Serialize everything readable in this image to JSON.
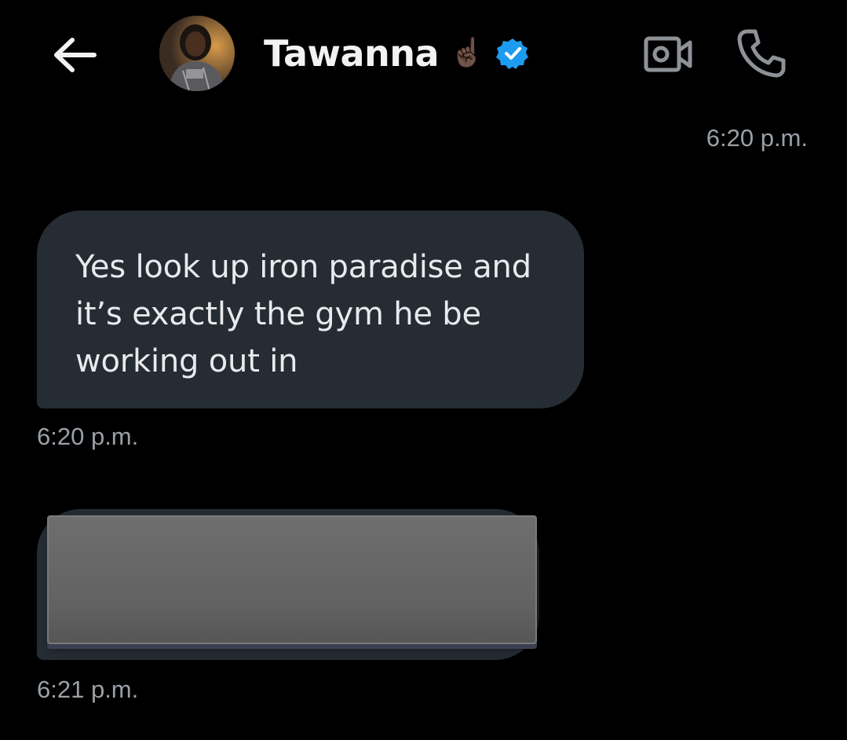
{
  "header": {
    "contact_name": "Tawanna",
    "name_emoji": "☝🏿",
    "verified": true,
    "icons": {
      "back": "arrow-left-icon",
      "video": "video-camera-icon",
      "call": "phone-icon",
      "verified": "verified-badge-icon"
    }
  },
  "messages": [
    {
      "direction": "outgoing-timestamp",
      "time": "6:20 p.m."
    },
    {
      "direction": "incoming",
      "text": "Yes look up iron paradise and\nit’s exactly the gym he be\nworking out in",
      "time": "6:20 p.m."
    },
    {
      "direction": "incoming",
      "text": "",
      "redacted": true,
      "time": "6:21 p.m."
    }
  ],
  "colors": {
    "background": "#000000",
    "bubble": "#252c33",
    "timestamp": "#9aa0a6",
    "verified": "#1d9bf0"
  }
}
